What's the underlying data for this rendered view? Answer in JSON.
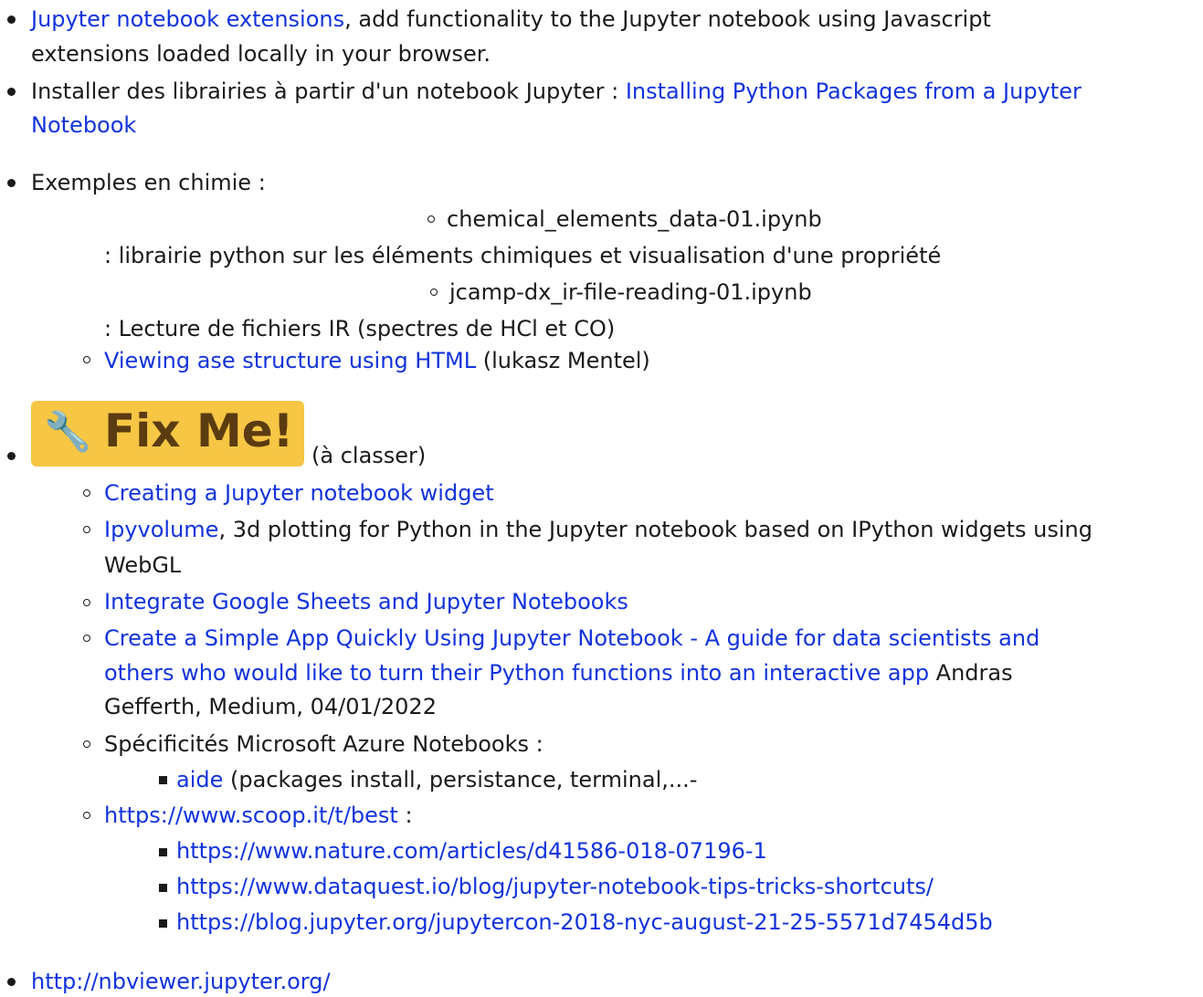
{
  "items": {
    "i1": {
      "link": "Jupyter notebook extensions",
      "text1": ", add functionality to the Jupyter notebook using Javascript",
      "text2": "extensions loaded locally in your browser."
    },
    "i2": {
      "text": "Installer des librairies à partir d'un notebook Jupyter : ",
      "link1": "Installing Python Packages from a Jupyter",
      "link2": "Notebook"
    },
    "i3": {
      "text": "Exemples en chimie :",
      "sub1": {
        "file": "chemical_elements_data-01.ipynb",
        "desc": ": librairie python sur les éléments chimiques et visualisation d'une propriété"
      },
      "sub2": {
        "file": "jcamp-dx_ir-file-reading-01.ipynb",
        "desc": ": Lecture de fichiers IR (spectres de HCl et CO)"
      },
      "sub3": {
        "link": "Viewing ase structure using HTML",
        "text": " (lukasz Mentel)"
      }
    },
    "i4": {
      "badge": {
        "icon": "wrench-icon",
        "glyph": "🔧",
        "label": "Fix Me!"
      },
      "text": "(à classer)",
      "s1": {
        "link": "Creating a Jupyter notebook widget"
      },
      "s2": {
        "link": "Ipyvolume",
        "text1": ", 3d plotting for Python in the Jupyter notebook based on IPython widgets using",
        "text2": "WebGL"
      },
      "s3": {
        "link": "Integrate Google Sheets and Jupyter Notebooks"
      },
      "s4": {
        "link1": "Create a Simple App Quickly Using Jupyter Notebook - A guide for data scientists and",
        "link2": "others who would like to turn their Python functions into an interactive app",
        "text1": " Andras",
        "text2": "Gefferth, Medium, 04/01/2022"
      },
      "s5": {
        "text": "Spécificités Microsoft Azure Notebooks :",
        "sub": {
          "link": "aide",
          "text": " (packages install, persistance, terminal,...-"
        }
      },
      "s6": {
        "link": "https://www.scoop.it/t/best",
        "text": " :",
        "subs": [
          "https://www.nature.com/articles/d41586-018-07196-1",
          "https://www.dataquest.io/blog/jupyter-notebook-tips-tricks-shortcuts/",
          "https://blog.jupyter.org/jupytercon-2018-nyc-august-21-25-5571d7454d5b"
        ]
      }
    },
    "i5": {
      "link": "http://nbviewer.jupyter.org/"
    }
  },
  "colors": {
    "link": "#1133dd",
    "text": "#1a1a1a",
    "badge": "#f6c644"
  }
}
